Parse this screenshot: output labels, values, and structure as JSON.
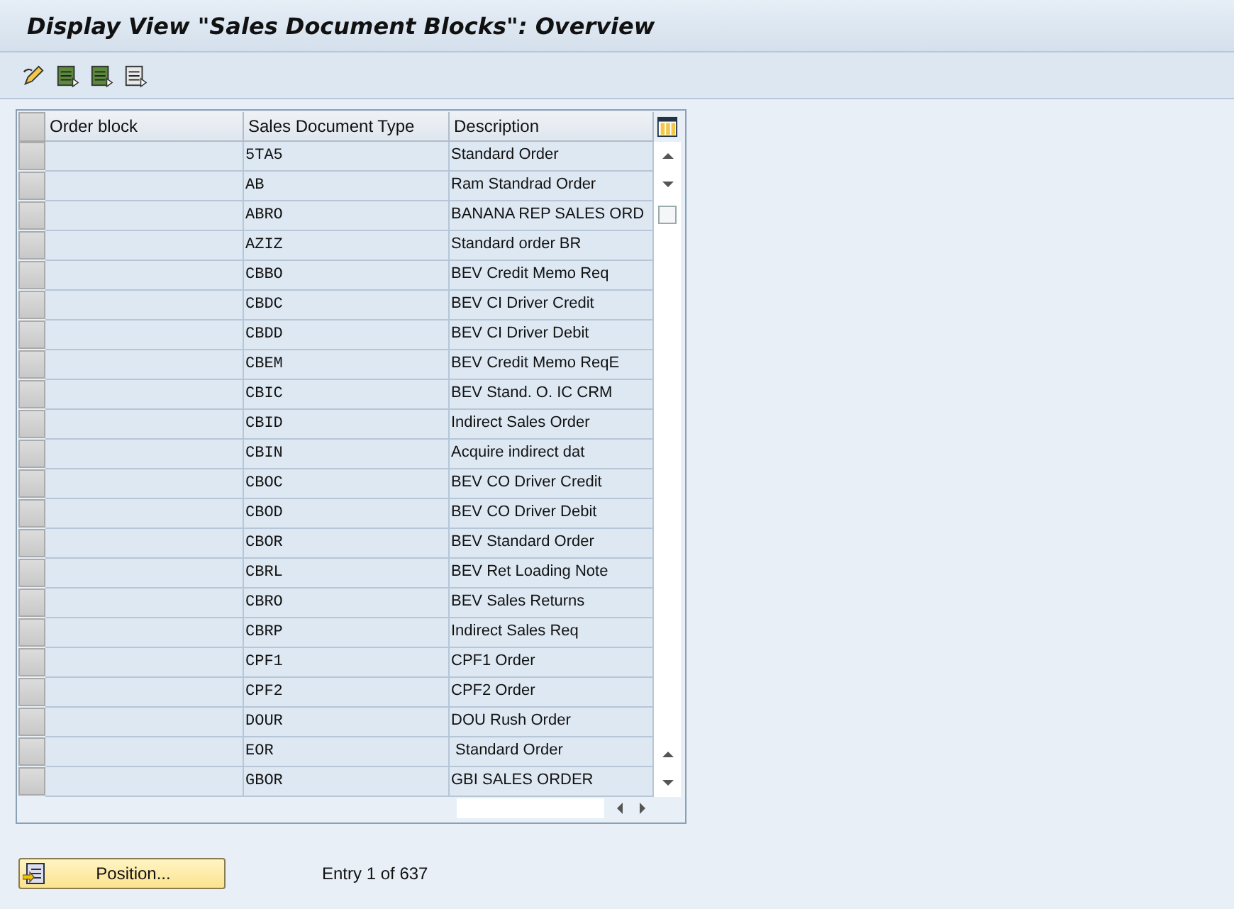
{
  "window": {
    "title": "Display View \"Sales Document Blocks\": Overview"
  },
  "table": {
    "columns": [
      "Order block",
      "Sales Document Type",
      "Description"
    ],
    "rows": [
      {
        "order_block": "",
        "type": "5TA5",
        "description": "Standard Order"
      },
      {
        "order_block": "",
        "type": "AB",
        "description": "Ram Standrad Order"
      },
      {
        "order_block": "",
        "type": "ABRO",
        "description": "BANANA REP SALES ORD"
      },
      {
        "order_block": "",
        "type": "AZIZ",
        "description": "Standard order BR"
      },
      {
        "order_block": "",
        "type": "CBBO",
        "description": "BEV Credit Memo Req"
      },
      {
        "order_block": "",
        "type": "CBDC",
        "description": "BEV CI Driver Credit"
      },
      {
        "order_block": "",
        "type": "CBDD",
        "description": "BEV CI Driver Debit"
      },
      {
        "order_block": "",
        "type": "CBEM",
        "description": "BEV Credit Memo ReqE"
      },
      {
        "order_block": "",
        "type": "CBIC",
        "description": "BEV Stand. O. IC CRM"
      },
      {
        "order_block": "",
        "type": "CBID",
        "description": "Indirect Sales Order"
      },
      {
        "order_block": "",
        "type": "CBIN",
        "description": "Acquire indirect dat"
      },
      {
        "order_block": "",
        "type": "CBOC",
        "description": "BEV CO Driver Credit"
      },
      {
        "order_block": "",
        "type": "CBOD",
        "description": "BEV CO Driver Debit"
      },
      {
        "order_block": "",
        "type": "CBOR",
        "description": "BEV Standard Order"
      },
      {
        "order_block": "",
        "type": "CBRL",
        "description": "BEV Ret Loading Note"
      },
      {
        "order_block": "",
        "type": "CBRO",
        "description": "BEV Sales Returns"
      },
      {
        "order_block": "",
        "type": "CBRP",
        "description": "Indirect Sales Req"
      },
      {
        "order_block": "",
        "type": "CPF1",
        "description": "CPF1 Order"
      },
      {
        "order_block": "",
        "type": "CPF2",
        "description": "CPF2 Order"
      },
      {
        "order_block": "",
        "type": "DOUR",
        "description": "DOU Rush Order"
      },
      {
        "order_block": "",
        "type": "EOR",
        "description": " Standard Order"
      },
      {
        "order_block": "",
        "type": "GBOR",
        "description": "GBI SALES ORDER"
      }
    ]
  },
  "position_button": {
    "label": "Position..."
  },
  "entry_info": "Entry 1 of 637"
}
